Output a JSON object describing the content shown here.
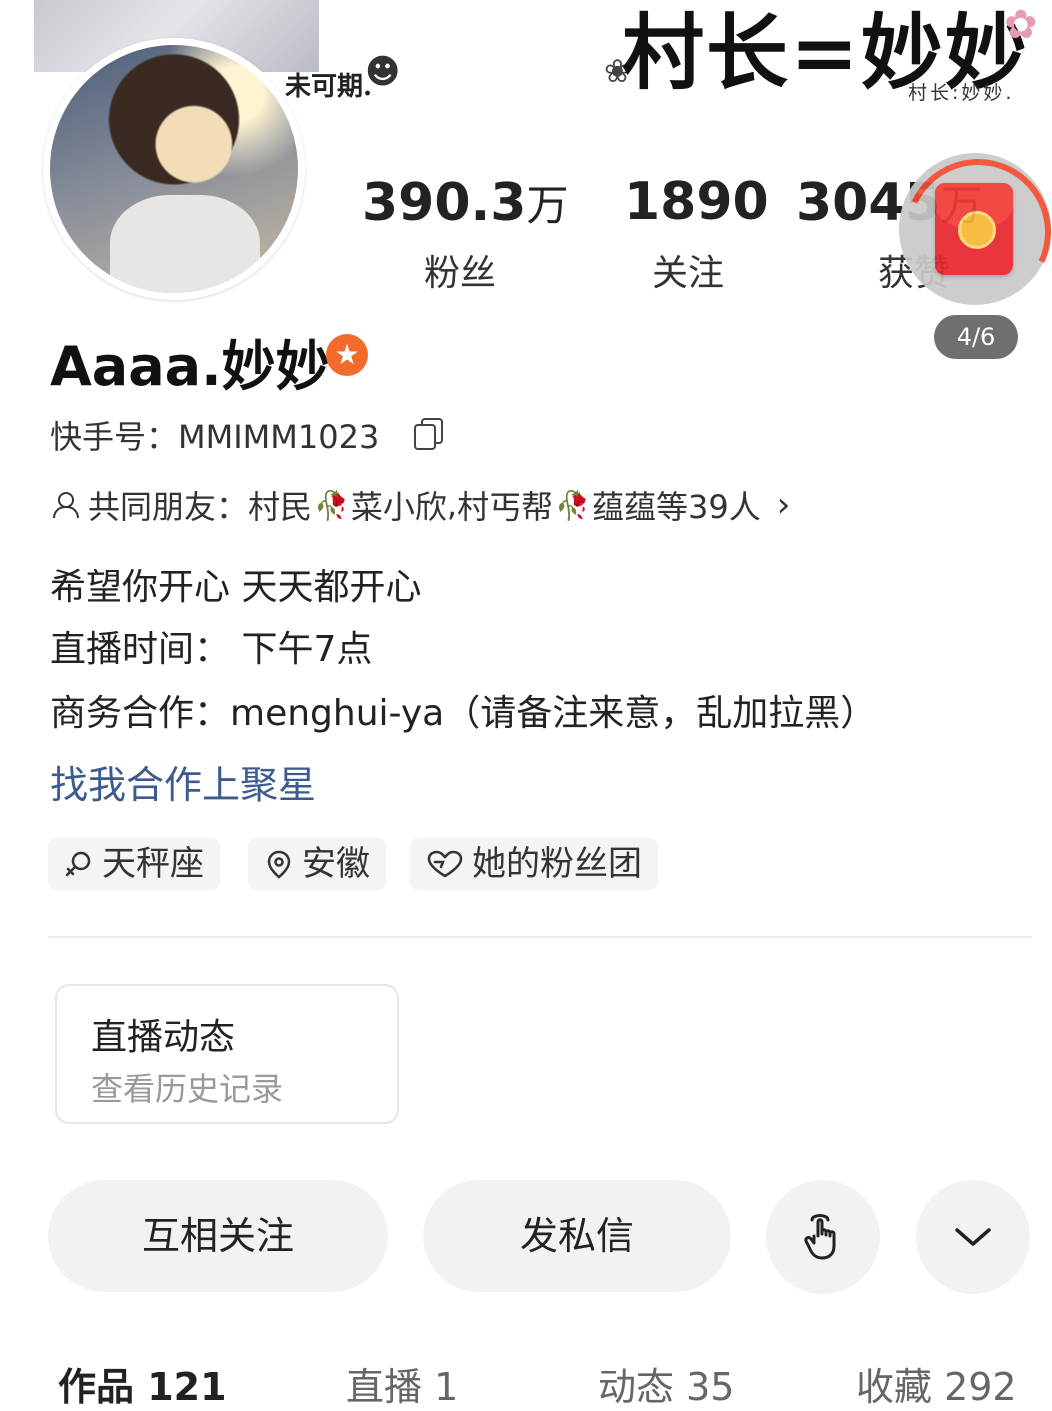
{
  "banner": {
    "caption": "未可期.",
    "title": "村长=妙妙",
    "subtitle": "村长:妙妙."
  },
  "stats": [
    {
      "value": "390.3",
      "unit": "万",
      "label": "粉丝"
    },
    {
      "value": "1890",
      "unit": "",
      "label": "关注"
    },
    {
      "value": "3045",
      "unit": "万",
      "label": "获赞"
    }
  ],
  "floating": {
    "page_indicator": "4/6"
  },
  "profile": {
    "name": "Aaaa.妙妙",
    "badge_symbol": "★",
    "id_label": "快手号：",
    "id_value": "MMIMM1023",
    "friends": {
      "label": "共同朋友：",
      "f1": "村民",
      "f2": "菜小欣",
      "sep": ", ",
      "f3": "村丐帮",
      "f4": "蕴蕴",
      "suffix": " 等39人"
    },
    "bio": [
      "希望你开心 天天都开心",
      "直播时间： 下午7点",
      "商务合作：menghui-ya（请备注来意，乱加拉黑）"
    ],
    "cooperation_link": "找我合作上聚星"
  },
  "tags": [
    "天秤座",
    "安徽",
    "她的粉丝团"
  ],
  "live_card": {
    "title": "直播动态",
    "subtitle": "查看历史记录"
  },
  "actions": {
    "follow": "互相关注",
    "message": "发私信"
  },
  "tabs": [
    "作品 121",
    "直播 1",
    "动态 35",
    "收藏 292"
  ],
  "colors": {
    "accent_orange": "#f36b2c",
    "link_blue": "#3d5a8f",
    "red_packet": "#e8262c"
  }
}
